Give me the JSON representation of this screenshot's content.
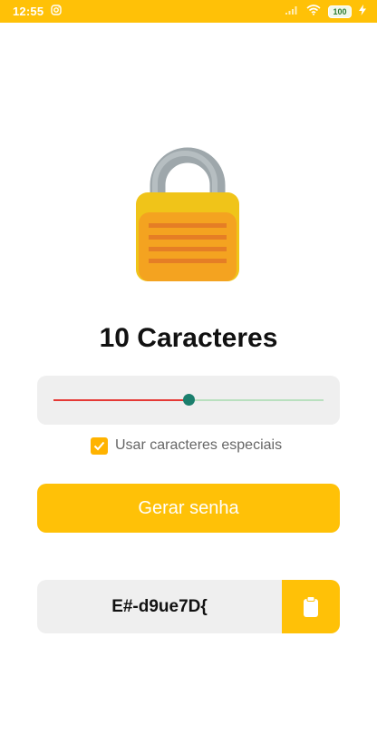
{
  "status_bar": {
    "time": "12:55",
    "battery": "100",
    "icons": [
      "instagram-icon",
      "signal-icon",
      "wifi-icon",
      "battery-icon",
      "charging-icon"
    ]
  },
  "hero": {
    "icon": "padlock-icon"
  },
  "length": {
    "title": "10 Caracteres"
  },
  "slider": {
    "value": 10,
    "fraction": 0.5
  },
  "special_chars": {
    "checked": true,
    "label": "Usar caracteres especiais"
  },
  "generate": {
    "label": "Gerar senha"
  },
  "password": {
    "value": "E#-d9ue7D{",
    "copy_icon": "clipboard-icon"
  },
  "colors": {
    "accent": "#FFC107",
    "slider_active": "#e53935",
    "slider_inactive": "#b9e0bf",
    "slider_thumb": "#1b7f6d"
  }
}
